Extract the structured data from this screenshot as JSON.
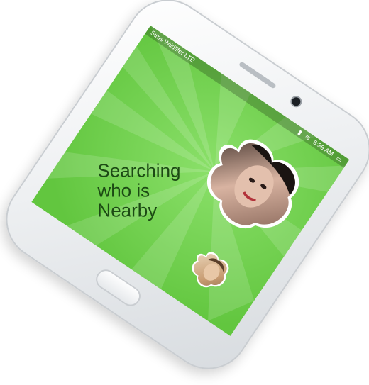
{
  "app": {
    "title": ""
  },
  "status_bar": {
    "carrier": "Sims Wildlifer LTE",
    "time": "6:39 AM",
    "signal_icon": "signal-icon",
    "wifi_icon": "wifi-icon",
    "battery_icon": "battery-icon"
  },
  "main": {
    "search_text": "Searching\nwho is\nNearby",
    "avatar_large_icon": "profile-photo",
    "avatar_small_icon": "profile-photo"
  },
  "colors": {
    "background": "#6fd24a",
    "text": "#1c4a14"
  }
}
